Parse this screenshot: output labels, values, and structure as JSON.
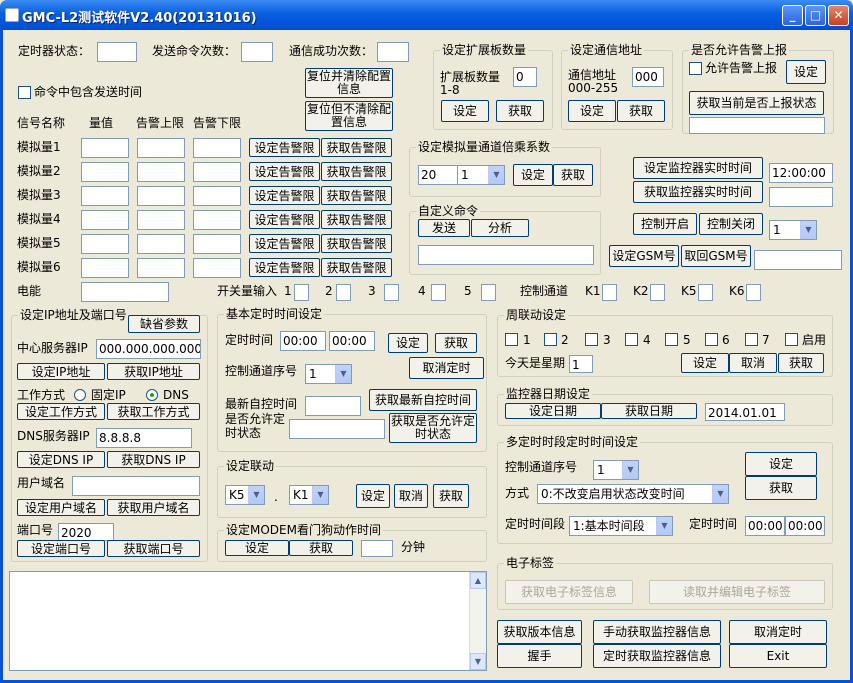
{
  "window": {
    "title": "GMC-L2测试软件V2.40(20131016)",
    "min": "_",
    "max": "□",
    "close": "✕"
  },
  "top": {
    "timer_state": "定时器状态：",
    "send_count": "发送命令次数：",
    "success_count": "通信成功次数：",
    "include_time": "命令中包含发送时间",
    "reset_clear": "复位并清除配置信息",
    "reset_keep": "复位但不清除配置信息"
  },
  "table": {
    "h_name": "信号名称",
    "h_value": "量值",
    "h_upper": "告警上限",
    "h_lower": "告警下限",
    "set_btn": "设定告警限",
    "get_btn": "获取告警限",
    "rows": [
      "模拟量1",
      "模拟量2",
      "模拟量3",
      "模拟量4",
      "模拟量5",
      "模拟量6"
    ],
    "power": "电能"
  },
  "expand": {
    "title": "设定扩展板数量",
    "label": "扩展板数量",
    "range": "1-8",
    "value": "0",
    "set": "设定",
    "get": "获取"
  },
  "comm": {
    "title": "设定通信地址",
    "label": "通信地址",
    "range": "000-255",
    "value": "000",
    "set": "设定",
    "get": "获取"
  },
  "alarm": {
    "title": "是否允许告警上报",
    "allow": "允许告警上报",
    "set": "设定",
    "get_state": "获取当前是否上报状态"
  },
  "multiplier": {
    "title": "设定模拟量通道倍乘系数",
    "value": "20",
    "channel": "1",
    "set": "设定",
    "get": "获取"
  },
  "custom": {
    "title": "自定义命令",
    "send": "发送",
    "parse": "分析"
  },
  "monitor": {
    "set_time": "设定监控器实时时间",
    "time_value": "12:00:00",
    "get_time": "获取监控器实时时间",
    "ctrl_on": "控制开启",
    "ctrl_off": "控制关闭",
    "ctrl_sel": "1",
    "set_gsm": "设定GSM号",
    "back_gsm": "取回GSM号"
  },
  "switch": {
    "label": "开关量输入",
    "nums": [
      "1",
      "2",
      "3",
      "4",
      "5"
    ],
    "ctrl_label": "控制通道",
    "ctrls": [
      "K1",
      "K2",
      "K5",
      "K6"
    ]
  },
  "ip": {
    "title": "设定IP地址及端口号",
    "default": "缺省参数",
    "center_label": "中心服务器IP",
    "center_value": "000.000.000.000",
    "set_ip": "设定IP地址",
    "get_ip": "获取IP地址",
    "mode_label": "工作方式",
    "mode_fixed": "固定IP",
    "mode_dns": "DNS",
    "set_mode": "设定工作方式",
    "get_mode": "获取工作方式",
    "dns_label": "DNS服务器IP",
    "dns_value": "8.8.8.8",
    "set_dns": "设定DNS IP",
    "get_dns": "获取DNS IP",
    "user_domain": "用户域名",
    "set_domain": "设定用户域名",
    "get_domain": "获取用户域名",
    "port_label": "端口号",
    "port_value": "2020",
    "set_port": "设定端口号",
    "get_port": "获取端口号"
  },
  "basic_timer": {
    "title": "基本定时时间设定",
    "time_label": "定时时间",
    "t1": "00:00",
    "t2": "00:00",
    "set": "设定",
    "get": "获取",
    "seq_label": "控制通道序号",
    "seq": "1",
    "cancel": "取消定时",
    "latest_label": "最新自控时间",
    "get_latest": "获取最新自控时间",
    "allow_label": "是否允许定时状态",
    "get_allow": "获取是否允许定时状态"
  },
  "linkage": {
    "title": "设定联动",
    "k_a": "K5",
    "k_b": "K1",
    "dot": ".",
    "set": "设定",
    "cancel": "取消",
    "get": "获取"
  },
  "modem": {
    "title": "设定MODEM看门狗动作时间",
    "set": "设定",
    "get": "获取",
    "unit": "分钟"
  },
  "week": {
    "title": "周联动设定",
    "days": [
      "1",
      "2",
      "3",
      "4",
      "5",
      "6",
      "7"
    ],
    "enable": "启用",
    "today": "今天是星期",
    "today_value": "1",
    "set": "设定",
    "cancel": "取消",
    "get": "获取"
  },
  "date": {
    "title": "监控器日期设定",
    "set": "设定日期",
    "get": "获取日期",
    "value": "2014.01.01"
  },
  "multi": {
    "title": "多定时时段定时时间设定",
    "seq_label": "控制通道序号",
    "seq": "1",
    "mode_label": "方式",
    "mode": "0:不改变启用状态改变时间",
    "period_label": "定时时间段",
    "period": "1:基本时间段",
    "time_label": "定时时间",
    "t1": "00:00",
    "t2": "00:00",
    "set": "设定",
    "get": "获取"
  },
  "tag": {
    "title": "电子标签",
    "get": "获取电子标签信息",
    "read_edit": "读取并编辑电子标签"
  },
  "bottom": {
    "get_version": "获取版本信息",
    "manual_get": "手动获取监控器信息",
    "cancel_timer": "取消定时",
    "handshake": "握手",
    "timer_get": "定时获取监控器信息",
    "exit": "Exit"
  }
}
